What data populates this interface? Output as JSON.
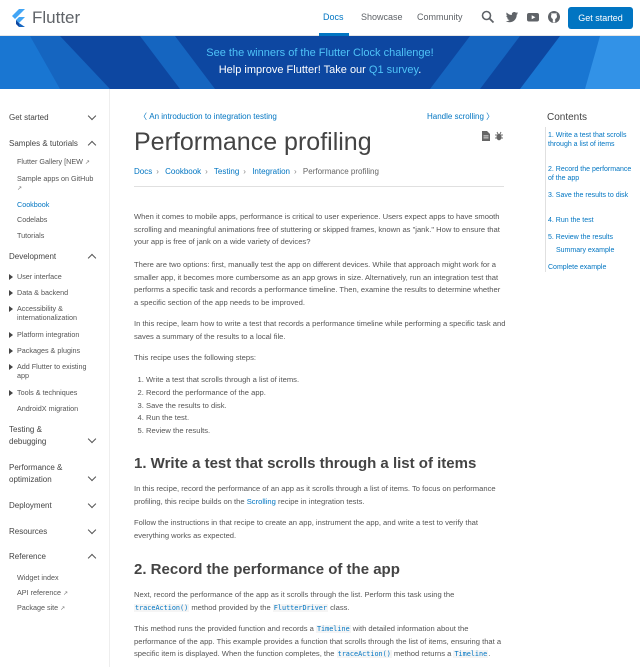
{
  "header": {
    "brand": "Flutter",
    "nav": {
      "docs": "Docs",
      "showcase": "Showcase",
      "community": "Community"
    },
    "get_started": "Get started",
    "icons": [
      "search-icon",
      "twitter-icon",
      "youtube-icon",
      "github-icon"
    ]
  },
  "banner": {
    "line1_prefix": "See the winners of the Flutter Clock challenge!",
    "line2_prefix": "Help improve Flutter! Take our ",
    "line2_link": "Q1 survey",
    "line2_suffix": "."
  },
  "sidebar": {
    "get_started": "Get started",
    "samples": "Samples & tutorials",
    "flutter_gallery": "Flutter Gallery [NEW",
    "sample_apps": "Sample apps on GitHub",
    "cookbook": "Cookbook",
    "codelabs": "Codelabs",
    "tutorials": "Tutorials",
    "development": "Development",
    "user_interface": "User interface",
    "data_backend": "Data & backend",
    "accessibility_1": "Accessibility &",
    "accessibility_2": "internationalization",
    "platform_integration": "Platform integration",
    "packages_plugins": "Packages & plugins",
    "add_flutter_1": "Add Flutter to existing",
    "add_flutter_2": "app",
    "tools": "Tools & techniques",
    "androidx": "AndroidX migration",
    "testing_1": "Testing &",
    "testing_2": "debugging",
    "performance_1": "Performance &",
    "performance_2": "optimization",
    "deployment": "Deployment",
    "resources": "Resources",
    "reference": "Reference",
    "widget_index": "Widget index",
    "api_reference": "API reference",
    "package_site": "Package site"
  },
  "page": {
    "prev": "An introduction to integration testing",
    "next": "Handle scrolling",
    "title": "Performance profiling",
    "breadcrumbs": [
      "Docs",
      "Cookbook",
      "Testing",
      "Integration",
      "Performance profiling"
    ],
    "p1": "When it comes to mobile apps, performance is critical to user experience. Users expect apps to have smooth scrolling and meaningful animations free of stuttering or skipped frames, known as \"jank.\" How to ensure that your app is free of jank on a wide variety of devices?",
    "p2": "There are two options: first, manually test the app on different devices. While that approach might work for a smaller app, it becomes more cumbersome as an app grows in size. Alternatively, run an integration test that performs a specific task and records a performance timeline. Then, examine the results to determine whether a specific section of the app needs to be improved.",
    "p3": "In this recipe, learn how to write a test that records a performance timeline while performing a specific task and saves a summary of the results to a local file.",
    "p4": "This recipe uses the following steps:",
    "steps": [
      "Write a test that scrolls through a list of items.",
      "Record the performance of the app.",
      "Save the results to disk.",
      "Run the test.",
      "Review the results."
    ],
    "h2_1": "1. Write a test that scrolls through a list of items",
    "p5_a": "In this recipe, record the performance of an app as it scrolls through a list of items. To focus on performance profiling, this recipe builds on the ",
    "p5_link": "Scrolling",
    "p5_b": " recipe in integration tests.",
    "p6": "Follow the instructions in that recipe to create an app, instrument the app, and write a test to verify that everything works as expected.",
    "h2_2": "2. Record the performance of the app",
    "p7_a": "Next, record the performance of the app as it scrolls through the list. Perform this task using the ",
    "p7_code1": "traceAction()",
    "p7_b": " method provided by the ",
    "p7_code2": "FlutterDriver",
    "p7_c": " class.",
    "p8_a": "This method runs the provided function and records a ",
    "p8_code1": "Timeline",
    "p8_b": " with detailed information about the performance of the app. This example provides a function that scrolls through the list of items, ensuring that a specific item is displayed. When the function completes, the ",
    "p8_code2": "traceAction()",
    "p8_c": " method returns a ",
    "p8_code3": "Timeline",
    "p8_d": "."
  },
  "toc": {
    "title": "Contents",
    "items": [
      "1. Write a test that scrolls through a list of items",
      "2. Record the performance of the app",
      "3. Save the results to disk",
      "4. Run the test",
      "5. Review the results",
      "Summary example",
      "Complete example"
    ]
  },
  "colors": {
    "accent": "#0175c2",
    "banner": "#0d47a1",
    "banner_link": "#4fc3f7"
  }
}
